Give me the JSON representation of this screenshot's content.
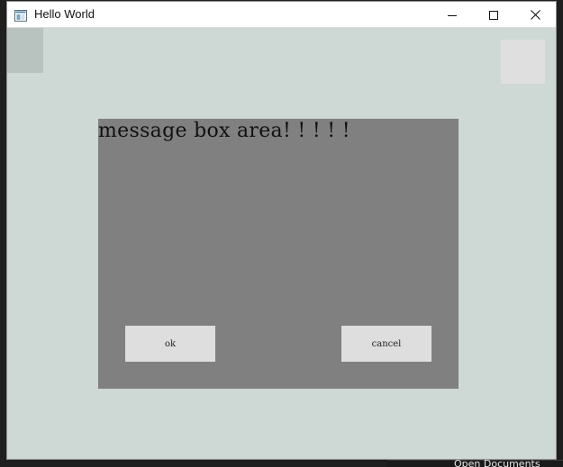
{
  "window": {
    "title": "Hello World",
    "controls": {
      "minimize": "minimize-icon",
      "maximize": "maximize-icon",
      "close": "close-icon"
    }
  },
  "message_box": {
    "text": "message box area! ! ! ! !",
    "ok_label": "ok",
    "cancel_label": "cancel"
  },
  "taskbar": {
    "label": "Open Documents"
  },
  "colors": {
    "client_background": "#ced8d5",
    "message_box_background": "#808080",
    "button_background": "#dedede",
    "corner_left": "#b8c3c0",
    "corner_right": "#dfdfdf"
  }
}
